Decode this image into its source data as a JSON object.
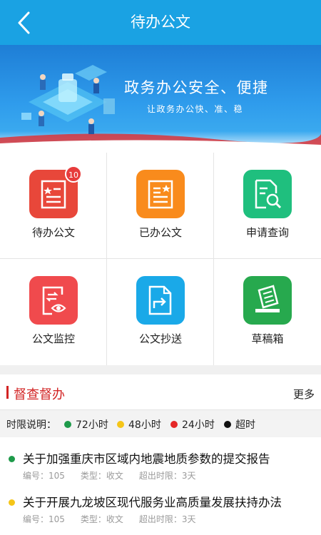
{
  "header": {
    "title": "待办公文",
    "back_icon": "chevron-left-icon"
  },
  "banner": {
    "slogan": "政务办公安全、便捷",
    "subtitle": "让政务办公快、准、稳"
  },
  "grid": {
    "items": [
      {
        "label": "待办公文",
        "icon": "pending-document-icon",
        "color": "#e8473a",
        "badge": "10"
      },
      {
        "label": "已办公文",
        "icon": "completed-document-icon",
        "color": "#f98b1c"
      },
      {
        "label": "申请查询",
        "icon": "document-search-icon",
        "color": "#1fbf7e"
      },
      {
        "label": "公文监控",
        "icon": "document-monitor-icon",
        "color": "#f04a4d"
      },
      {
        "label": "公文抄送",
        "icon": "document-forward-icon",
        "color": "#1aa9e8"
      },
      {
        "label": "草稿箱",
        "icon": "draft-box-icon",
        "color": "#27a94e"
      }
    ]
  },
  "supervise": {
    "title": "督查督办",
    "more": "更多",
    "legend": {
      "label": "时限说明：",
      "items": [
        {
          "label": "72小时",
          "color": "#1e9a4a"
        },
        {
          "label": "48小时",
          "color": "#f5c518"
        },
        {
          "label": "24小时",
          "color": "#e52727"
        },
        {
          "label": "超时",
          "color": "#111111"
        }
      ]
    },
    "documents": [
      {
        "title": "关于加强重庆市区域内地震地质参数的提交报告",
        "number": "编号：105",
        "type": "类型：收文",
        "overdue": "超出时限：3天",
        "dot_color": "#1e9a4a"
      },
      {
        "title": "关于开展九龙坡区现代服务业高质量发展扶持办法",
        "number": "编号：105",
        "type": "类型：收文",
        "overdue": "超出时限：3天",
        "dot_color": "#f5c518"
      }
    ]
  }
}
